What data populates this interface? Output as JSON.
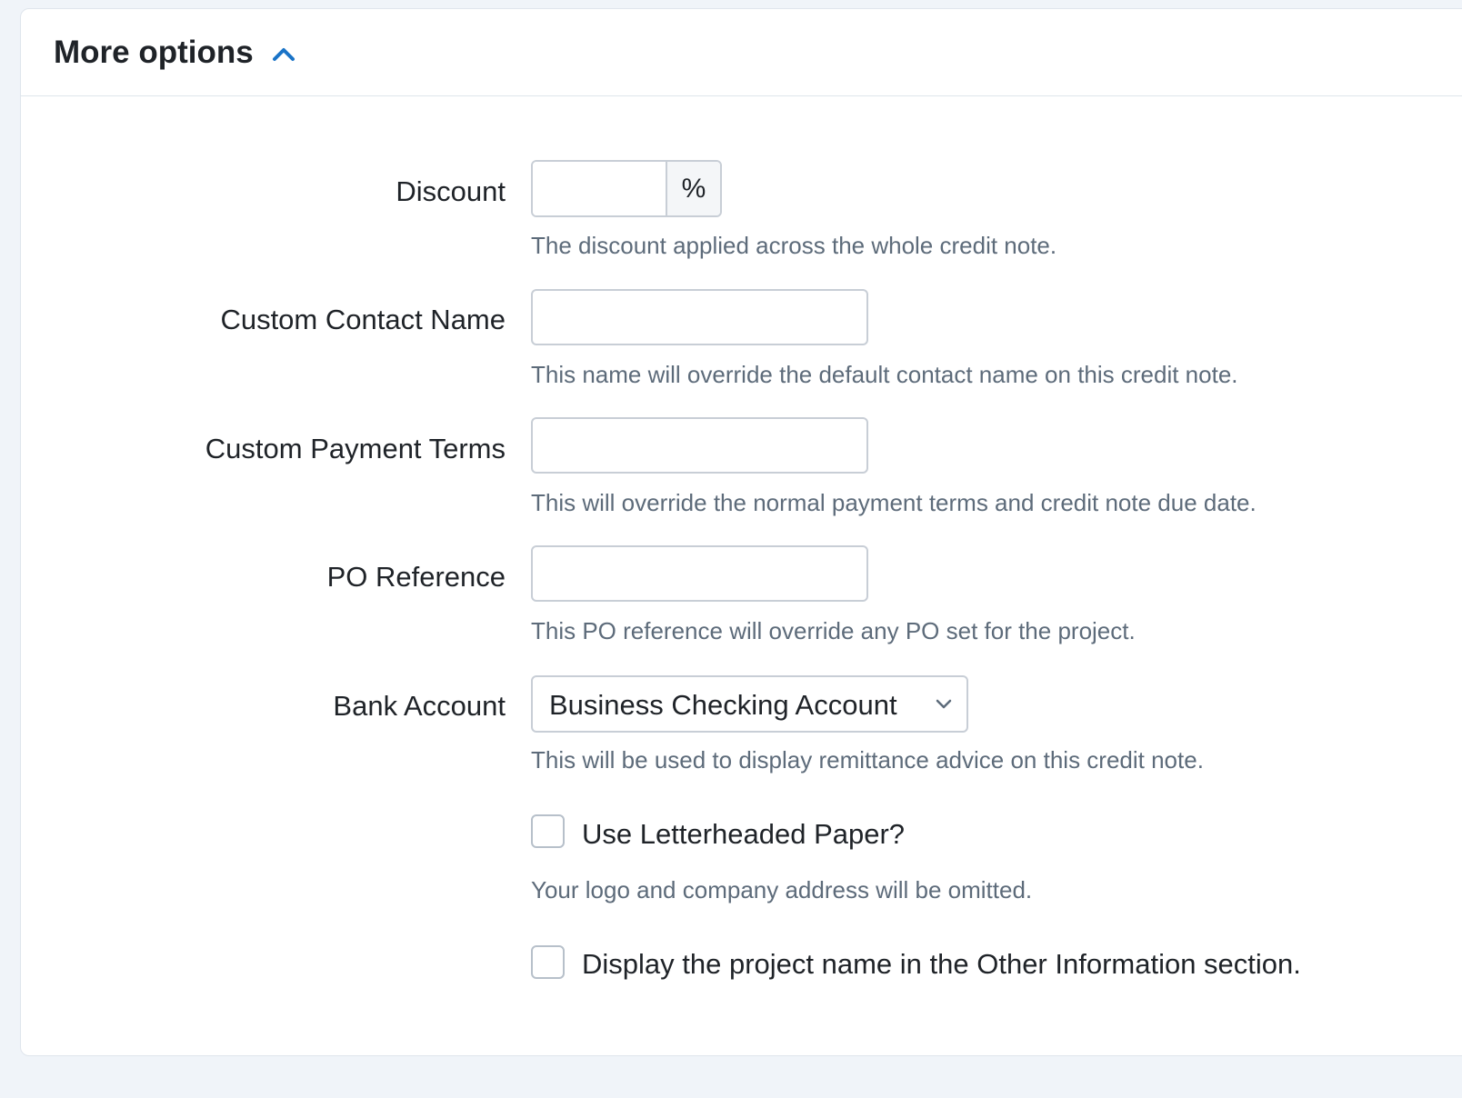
{
  "section": {
    "title": "More options",
    "toggle_icon": "chevron-up-icon",
    "accent_color": "#1a73c7"
  },
  "fields": {
    "discount": {
      "label": "Discount",
      "value": "",
      "addon": "%",
      "help": "The discount applied across the whole credit note."
    },
    "custom_contact_name": {
      "label": "Custom Contact Name",
      "value": "",
      "help": "This name will override the default contact name on this credit note."
    },
    "custom_payment_terms": {
      "label": "Custom Payment Terms",
      "value": "",
      "help": "This will override the normal payment terms and credit note due date."
    },
    "po_reference": {
      "label": "PO Reference",
      "value": "",
      "help": "This PO reference will override any PO set for the project."
    },
    "bank_account": {
      "label": "Bank Account",
      "selected": "Business Checking Account",
      "help": "This will be used to display remittance advice on this credit note."
    }
  },
  "checkboxes": {
    "letterhead": {
      "label": "Use Letterheaded Paper?",
      "checked": false,
      "help": "Your logo and company address will be omitted."
    },
    "project_name": {
      "label": "Display the project name in the Other Information section.",
      "checked": false
    }
  }
}
